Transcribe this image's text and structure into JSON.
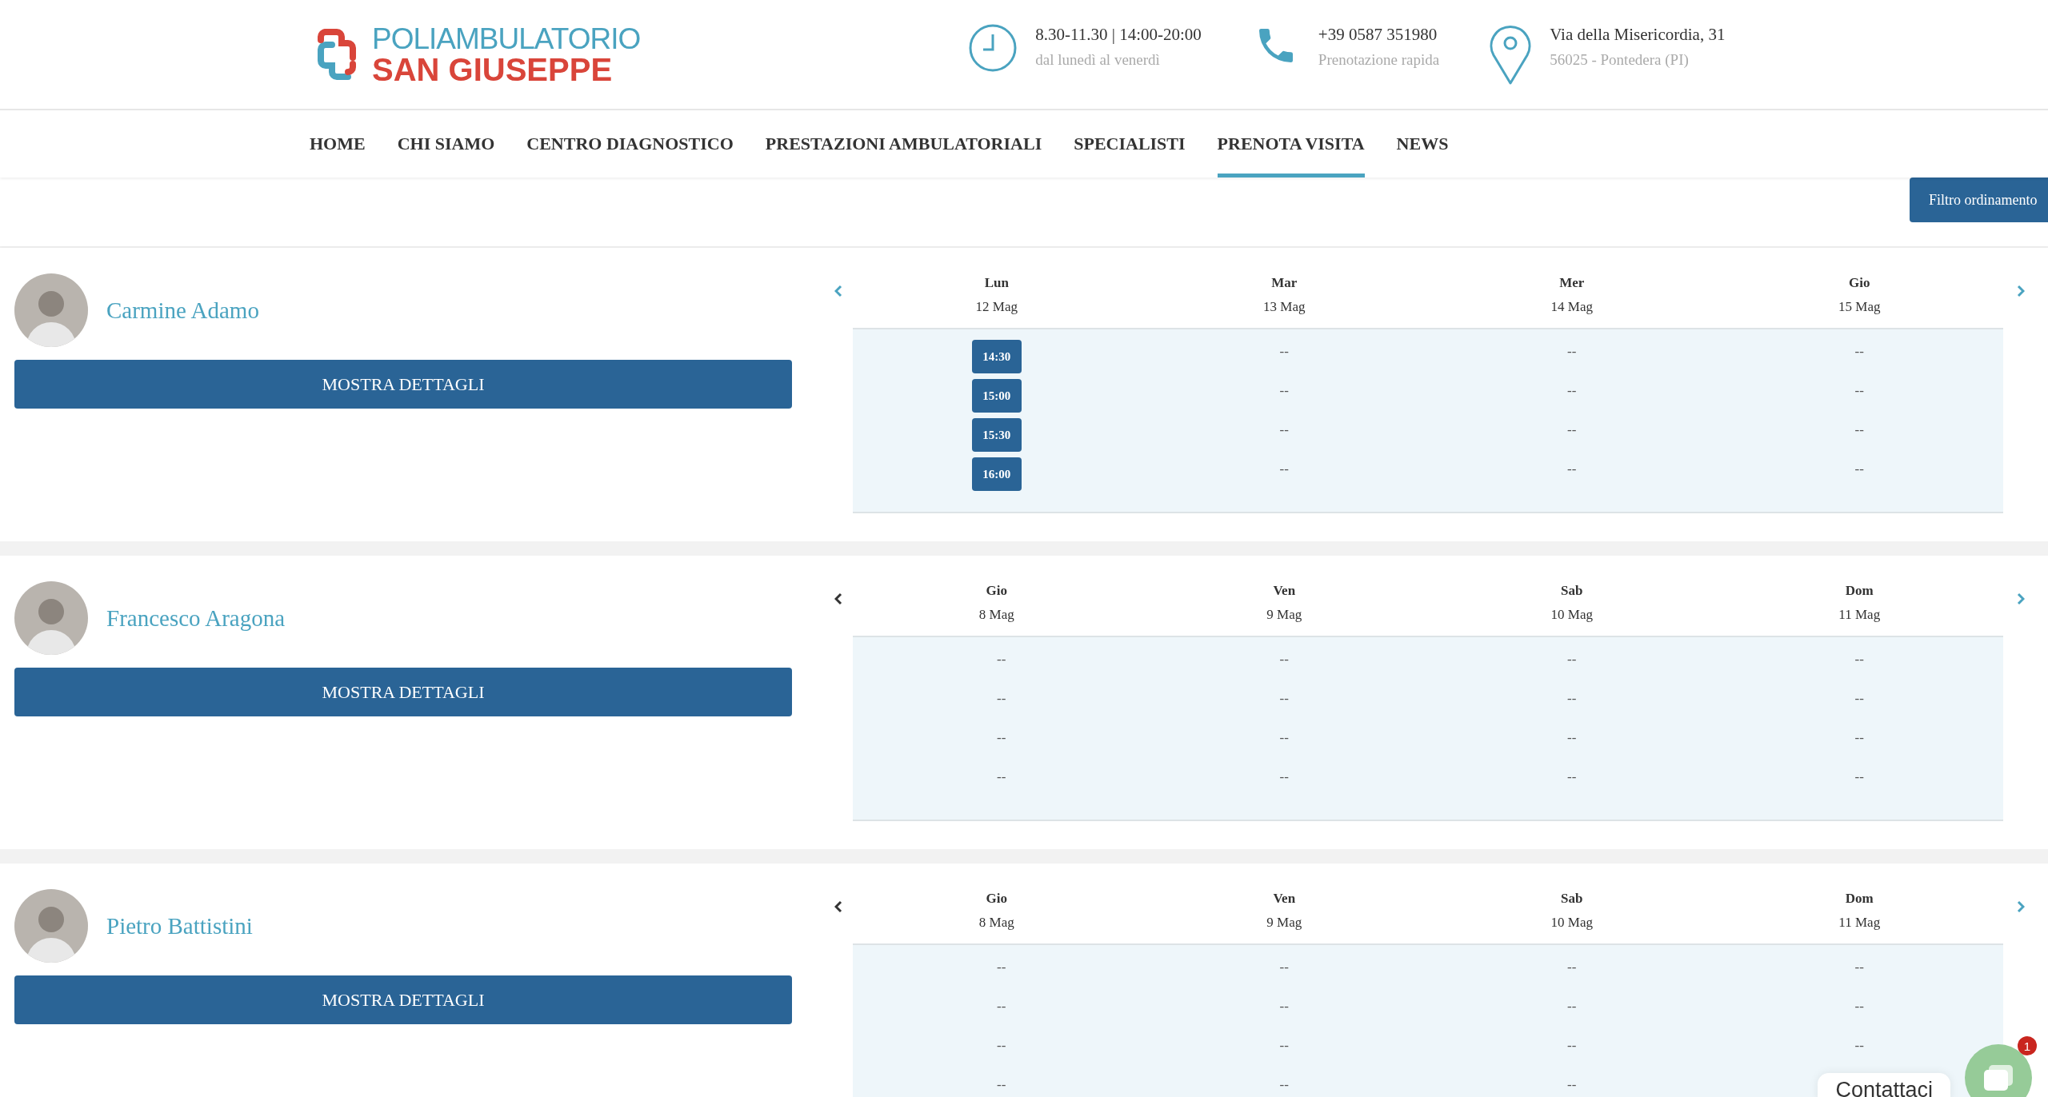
{
  "logo": {
    "line_1": "POLIAMBULATORIO",
    "line_2": "SAN GIUSEPPE"
  },
  "info": [
    {
      "kind": "clock",
      "title": "8.30-11.30 | 14:00-20:00",
      "subtitle": "dal lunedì al venerdì"
    },
    {
      "kind": "phone",
      "title": "+39 0587 351980",
      "subtitle": "Prenotazione rapida"
    },
    {
      "kind": "pin",
      "title": "Via della Misericordia, 31",
      "subtitle": "56025 - Pontedera (PI)"
    }
  ],
  "nav": [
    {
      "label": "HOME",
      "selected": false
    },
    {
      "label": "CHI SIAMO",
      "selected": false
    },
    {
      "label": "CENTRO DIAGNOSTICO",
      "selected": false
    },
    {
      "label": "PRESTAZIONI AMBULATORIALI",
      "selected": false
    },
    {
      "label": "SPECIALISTI",
      "selected": false
    },
    {
      "label": "PRENOTA VISITA",
      "selected": true
    },
    {
      "label": "NEWS",
      "selected": false
    }
  ],
  "filter_button": "Filtro ordinamento",
  "doctors": [
    {
      "name": "Carmine Adamo",
      "button": "MOSTRA DETTAGLI",
      "prev_disabled": false,
      "days": [
        {
          "day": "Lun",
          "date": "12 Mag",
          "slots": [
            {
              "kind": "time",
              "text": "14:30"
            },
            {
              "kind": "time",
              "text": "15:00"
            },
            {
              "kind": "time",
              "text": "15:30"
            },
            {
              "kind": "time",
              "text": "16:00"
            }
          ]
        },
        {
          "day": "Mar",
          "date": "13 Mag",
          "slots": [
            {
              "kind": "empty",
              "text": "--"
            },
            {
              "kind": "empty",
              "text": "--"
            },
            {
              "kind": "empty",
              "text": "--"
            },
            {
              "kind": "empty",
              "text": "--"
            }
          ]
        },
        {
          "day": "Mer",
          "date": "14 Mag",
          "slots": [
            {
              "kind": "empty",
              "text": "--"
            },
            {
              "kind": "empty",
              "text": "--"
            },
            {
              "kind": "empty",
              "text": "--"
            },
            {
              "kind": "empty",
              "text": "--"
            }
          ]
        },
        {
          "day": "Gio",
          "date": "15 Mag",
          "slots": [
            {
              "kind": "empty",
              "text": "--"
            },
            {
              "kind": "empty",
              "text": "--"
            },
            {
              "kind": "empty",
              "text": "--"
            },
            {
              "kind": "empty",
              "text": "--"
            }
          ]
        }
      ]
    },
    {
      "name": "Francesco Aragona",
      "button": "MOSTRA DETTAGLI",
      "prev_disabled": true,
      "days": [
        {
          "day": "Gio",
          "date": "8 Mag",
          "slots": [
            {
              "kind": "empty",
              "text": "--"
            },
            {
              "kind": "empty",
              "text": "--"
            },
            {
              "kind": "empty",
              "text": "--"
            },
            {
              "kind": "empty",
              "text": "--"
            }
          ]
        },
        {
          "day": "Ven",
          "date": "9 Mag",
          "slots": [
            {
              "kind": "empty",
              "text": "--"
            },
            {
              "kind": "empty",
              "text": "--"
            },
            {
              "kind": "empty",
              "text": "--"
            },
            {
              "kind": "empty",
              "text": "--"
            }
          ]
        },
        {
          "day": "Sab",
          "date": "10 Mag",
          "slots": [
            {
              "kind": "empty",
              "text": "--"
            },
            {
              "kind": "empty",
              "text": "--"
            },
            {
              "kind": "empty",
              "text": "--"
            },
            {
              "kind": "empty",
              "text": "--"
            }
          ]
        },
        {
          "day": "Dom",
          "date": "11 Mag",
          "slots": [
            {
              "kind": "empty",
              "text": "--"
            },
            {
              "kind": "empty",
              "text": "--"
            },
            {
              "kind": "empty",
              "text": "--"
            },
            {
              "kind": "empty",
              "text": "--"
            }
          ]
        }
      ]
    },
    {
      "name": "Pietro Battistini",
      "button": "MOSTRA DETTAGLI",
      "prev_disabled": true,
      "days": [
        {
          "day": "Gio",
          "date": "8 Mag",
          "slots": [
            {
              "kind": "empty",
              "text": "--"
            },
            {
              "kind": "empty",
              "text": "--"
            },
            {
              "kind": "empty",
              "text": "--"
            },
            {
              "kind": "empty",
              "text": "--"
            }
          ]
        },
        {
          "day": "Ven",
          "date": "9 Mag",
          "slots": [
            {
              "kind": "empty",
              "text": "--"
            },
            {
              "kind": "empty",
              "text": "--"
            },
            {
              "kind": "empty",
              "text": "--"
            },
            {
              "kind": "empty",
              "text": "--"
            }
          ]
        },
        {
          "day": "Sab",
          "date": "10 Mag",
          "slots": [
            {
              "kind": "empty",
              "text": "--"
            },
            {
              "kind": "empty",
              "text": "--"
            },
            {
              "kind": "empty",
              "text": "--"
            },
            {
              "kind": "empty",
              "text": "--"
            }
          ]
        },
        {
          "day": "Dom",
          "date": "11 Mag",
          "slots": [
            {
              "kind": "empty",
              "text": "--"
            },
            {
              "kind": "empty",
              "text": "--"
            },
            {
              "kind": "empty",
              "text": "--"
            }
          ]
        }
      ]
    }
  ],
  "chat": {
    "label": "Contattaci",
    "badge": "1"
  }
}
